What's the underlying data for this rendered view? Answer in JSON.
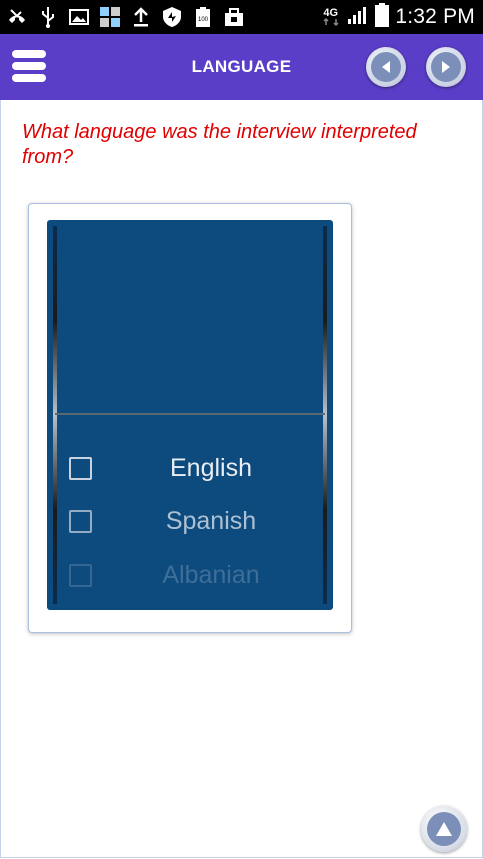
{
  "status_bar": {
    "time": "1:32 PM",
    "network": "4G",
    "icons": [
      "missed-call-icon",
      "usb-icon",
      "image-icon",
      "app-icon",
      "upload-icon",
      "shield-icon",
      "battery-100-icon",
      "briefcase-icon",
      "signal-icon",
      "battery-icon"
    ],
    "battery_label": "100"
  },
  "app_bar": {
    "title": "LANGUAGE",
    "background_color": "#5a3ec8"
  },
  "question": {
    "text": "What language was the interview interpreted from?",
    "color": "#e00000"
  },
  "picker": {
    "options": [
      {
        "label": "English",
        "checked": false
      },
      {
        "label": "Spanish",
        "checked": false
      },
      {
        "label": "Albanian",
        "checked": false
      }
    ],
    "background_color": "#0d4a7e"
  }
}
